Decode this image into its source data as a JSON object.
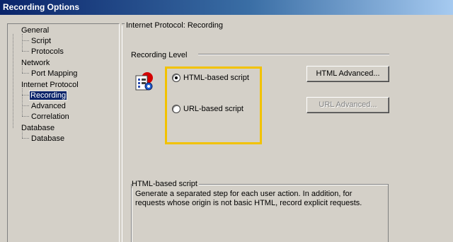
{
  "window": {
    "title": "Recording Options"
  },
  "tree": {
    "items": [
      {
        "label": "General",
        "level": 0
      },
      {
        "label": "Script",
        "level": 1
      },
      {
        "label": "Protocols",
        "level": 1
      },
      {
        "label": "Network",
        "level": 0
      },
      {
        "label": "Port Mapping",
        "level": 1
      },
      {
        "label": "Internet Protocol",
        "level": 0
      },
      {
        "label": "Recording",
        "level": 1,
        "selected": true
      },
      {
        "label": "Advanced",
        "level": 1
      },
      {
        "label": "Correlation",
        "level": 1
      },
      {
        "label": "Database",
        "level": 0
      },
      {
        "label": "Database",
        "level": 1
      }
    ]
  },
  "page": {
    "section_title": "Internet Protocol: Recording",
    "recording_level_label": "Recording Level",
    "options": {
      "html": {
        "label": "HTML-based script",
        "checked": true
      },
      "url": {
        "label": "URL-based script",
        "checked": false
      }
    },
    "buttons": {
      "html_advanced": "HTML Advanced...",
      "url_advanced": "URL Advanced..."
    },
    "description": {
      "title": "HTML-based script",
      "text": "Generate a separated step for each user action. In addition, for requests whose origin is not basic HTML, record explicit requests."
    }
  },
  "icons": {
    "recording": "recording-level-icon",
    "highlight_color": "#f2c200"
  }
}
